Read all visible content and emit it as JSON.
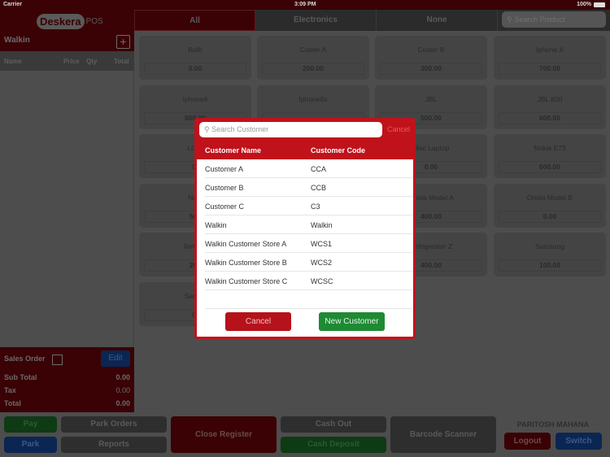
{
  "status_bar": {
    "carrier": "Carrier",
    "time": "3:09 PM",
    "battery": "100%"
  },
  "sidebar": {
    "logo": {
      "brand": "Deskera",
      "suffix": "POS"
    },
    "customer": "Walkin",
    "add_icon": "+",
    "cart_columns": [
      "Name",
      "Price",
      "Qty",
      "Total"
    ],
    "sales_order_label": "Sales Order",
    "sales_order_checked": false,
    "edit_label": "Edit",
    "totals": [
      {
        "label": "Sub Total",
        "value": "0.00"
      },
      {
        "label": "Tax",
        "value": "0.00"
      },
      {
        "label": "Total",
        "value": "0.00"
      }
    ]
  },
  "category_tabs": [
    {
      "label": "All",
      "active": true
    },
    {
      "label": "Electronics",
      "active": false
    },
    {
      "label": "None",
      "active": false
    }
  ],
  "product_search": {
    "placeholder": "Search Product"
  },
  "products": [
    {
      "name": "Bulb",
      "price": "0.00"
    },
    {
      "name": "Cooler  A",
      "price": "200.00"
    },
    {
      "name": "Cooler  B",
      "price": "300.00"
    },
    {
      "name": "Iphone X",
      "price": "700.00"
    },
    {
      "name": "Iphone6",
      "price": "800.00"
    },
    {
      "name": "Iphone6s",
      "price": ""
    },
    {
      "name": "JBL",
      "price": "500.00"
    },
    {
      "name": "JBL 800",
      "price": "600.00"
    },
    {
      "name": "LG B",
      "price": "0."
    },
    {
      "name": "",
      "price": ""
    },
    {
      "name": "Mac Laptop",
      "price": "0.00"
    },
    {
      "name": "Nokia E73",
      "price": "600.00"
    },
    {
      "name": "Noki",
      "price": "500"
    },
    {
      "name": "",
      "price": ""
    },
    {
      "name": "Onida Model A",
      "price": "400.00"
    },
    {
      "name": "Onida Model B",
      "price": "0.00"
    },
    {
      "name": "Refrige",
      "price": "200"
    },
    {
      "name": "",
      "price": ""
    },
    {
      "name": "Refrigerator Z",
      "price": "400.00"
    },
    {
      "name": "Samsung",
      "price": "100.00"
    },
    {
      "name": "Samsu",
      "price": "0."
    }
  ],
  "actions": {
    "pay": "Pay",
    "park": "Park",
    "park_orders": "Park Orders",
    "reports": "Reports",
    "close_register": "Close Register",
    "cash_out": "Cash Out",
    "cash_deposit": "Cash Deposit",
    "barcode_scanner": "Barcode Scanner",
    "user_name": "PARITOSH MAHANA",
    "logout": "Logout",
    "switch": "Switch"
  },
  "customer_modal": {
    "search_placeholder": "Search Customer",
    "top_cancel": "Cancel",
    "columns": {
      "name": "Customer Name",
      "code": "Customer Code"
    },
    "customers": [
      {
        "name": "Customer A",
        "code": "CCA"
      },
      {
        "name": "Customer B",
        "code": "CCB"
      },
      {
        "name": "Customer C",
        "code": "C3"
      },
      {
        "name": "Walkin",
        "code": "Walkin"
      },
      {
        "name": "Walkin Customer Store A",
        "code": "WCS1"
      },
      {
        "name": "Walkin Customer Store B",
        "code": "WCS2"
      },
      {
        "name": "Walkin Customer Store C",
        "code": "WCSC"
      }
    ],
    "cancel_label": "Cancel",
    "new_customer_label": "New Customer"
  },
  "colors": {
    "brand_red": "#c0121b",
    "action_green": "#1e8a34",
    "action_blue": "#0b2652"
  }
}
